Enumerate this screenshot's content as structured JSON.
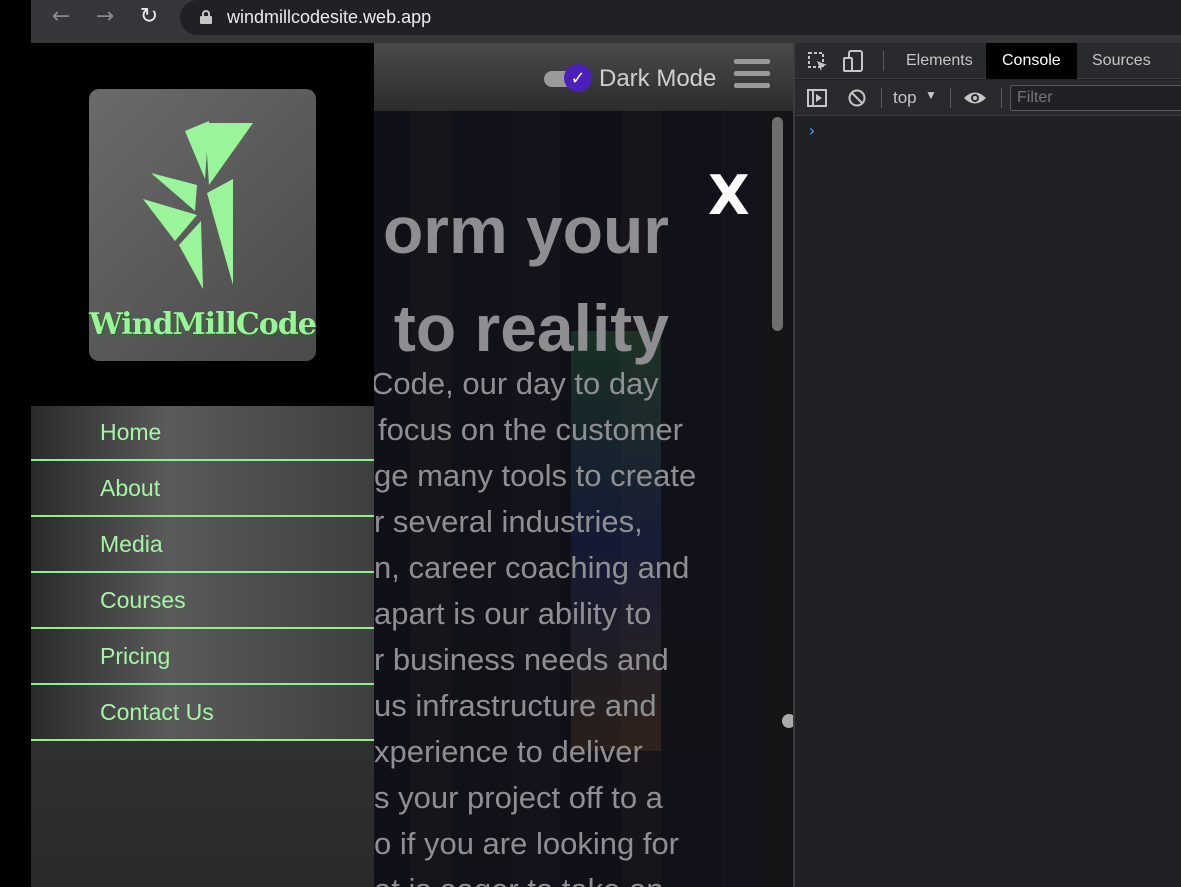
{
  "browser": {
    "url": "windmillcodesite.web.app",
    "back_glyph": "←",
    "forward_glyph": "→",
    "reload_glyph": "↻"
  },
  "site": {
    "header": {
      "dark_mode_label": "Dark Mode",
      "dark_mode_checked": true,
      "toggle_check": "✓"
    },
    "close_label": "X",
    "hero": {
      "title_lines": [
        "orm your",
        "to reality"
      ],
      "body_lines": [
        "Code, our day to day",
        "focus on the customer",
        "ge many tools to create",
        "r several industries,",
        "n, career coaching and",
        "apart is our ability to",
        "r business needs and",
        "us infrastructure and",
        "xperience to deliver",
        "s your project off to a",
        "o if you are looking for",
        "at is eager to take on"
      ]
    }
  },
  "sidebar": {
    "logo_text": "WindMillCode",
    "menu": [
      {
        "label": "Home"
      },
      {
        "label": "About"
      },
      {
        "label": "Media"
      },
      {
        "label": "Courses"
      },
      {
        "label": "Pricing"
      },
      {
        "label": "Contact Us"
      }
    ]
  },
  "devtools": {
    "tabs": [
      {
        "label": "Elements",
        "active": false
      },
      {
        "label": "Console",
        "active": true
      },
      {
        "label": "Sources",
        "active": false
      }
    ],
    "context": "top",
    "context_arrow": "▼",
    "filter_placeholder": "Filter",
    "prompt": "›"
  },
  "colors": {
    "accent_green": "#a6f5a6",
    "toggle_purple": "#4b1fb8",
    "devtools_bg": "#202124"
  }
}
